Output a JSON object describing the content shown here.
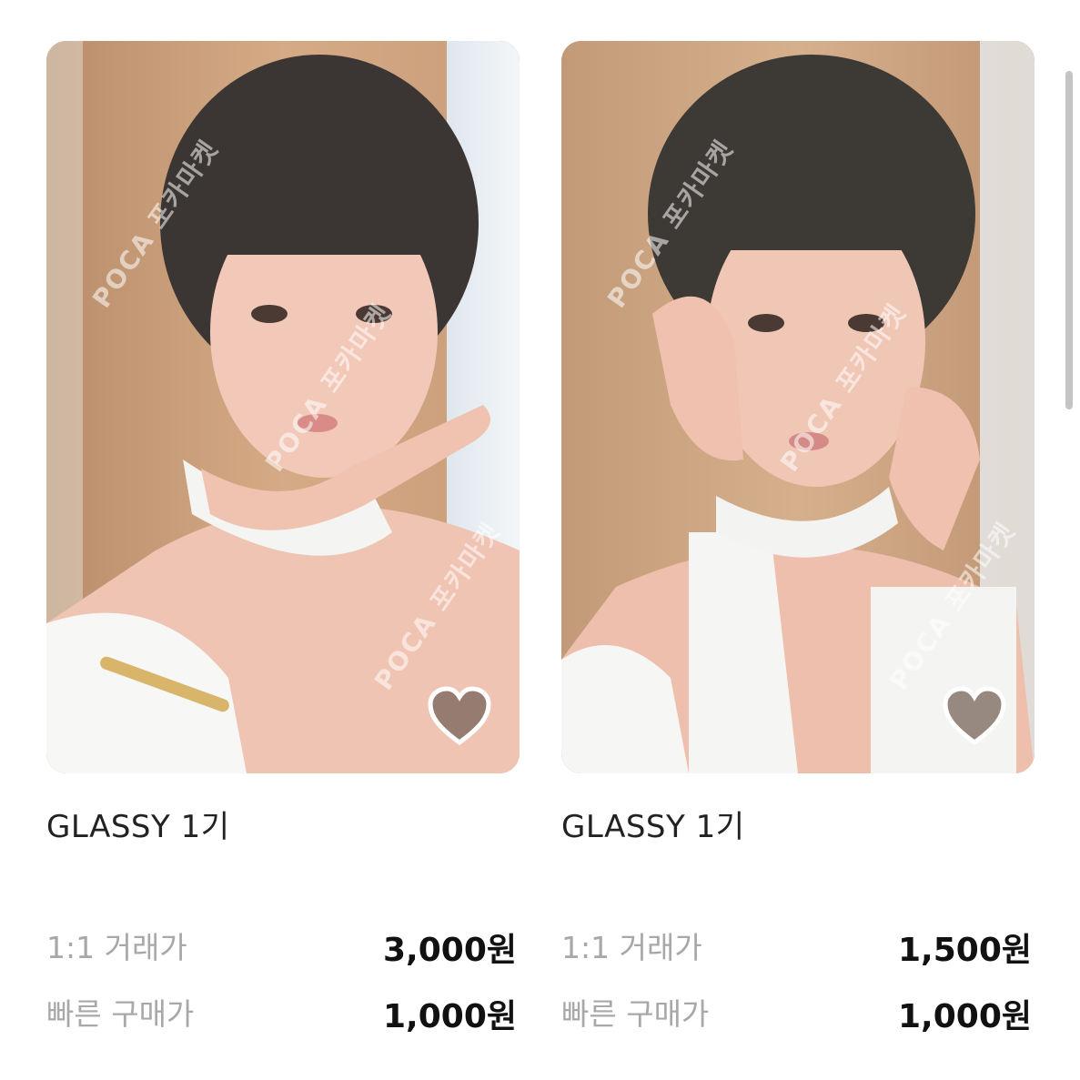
{
  "listings": [
    {
      "title": "GLASSY 1기",
      "watermark": "POCA 포카마켓",
      "prices": [
        {
          "label": "1:1 거래가",
          "value": "3,000원"
        },
        {
          "label": "빠른 구매가",
          "value": "1,000원"
        }
      ],
      "favorite_icon": "heart-icon"
    },
    {
      "title": "GLASSY 1기",
      "watermark": "POCA 포카마켓",
      "prices": [
        {
          "label": "1:1 거래가",
          "value": "1,500원"
        },
        {
          "label": "빠른 구매가",
          "value": "1,000원"
        }
      ],
      "favorite_icon": "heart-icon"
    }
  ],
  "colors": {
    "text_primary": "#222222",
    "text_muted": "#a8a8a8",
    "price": "#111111"
  }
}
